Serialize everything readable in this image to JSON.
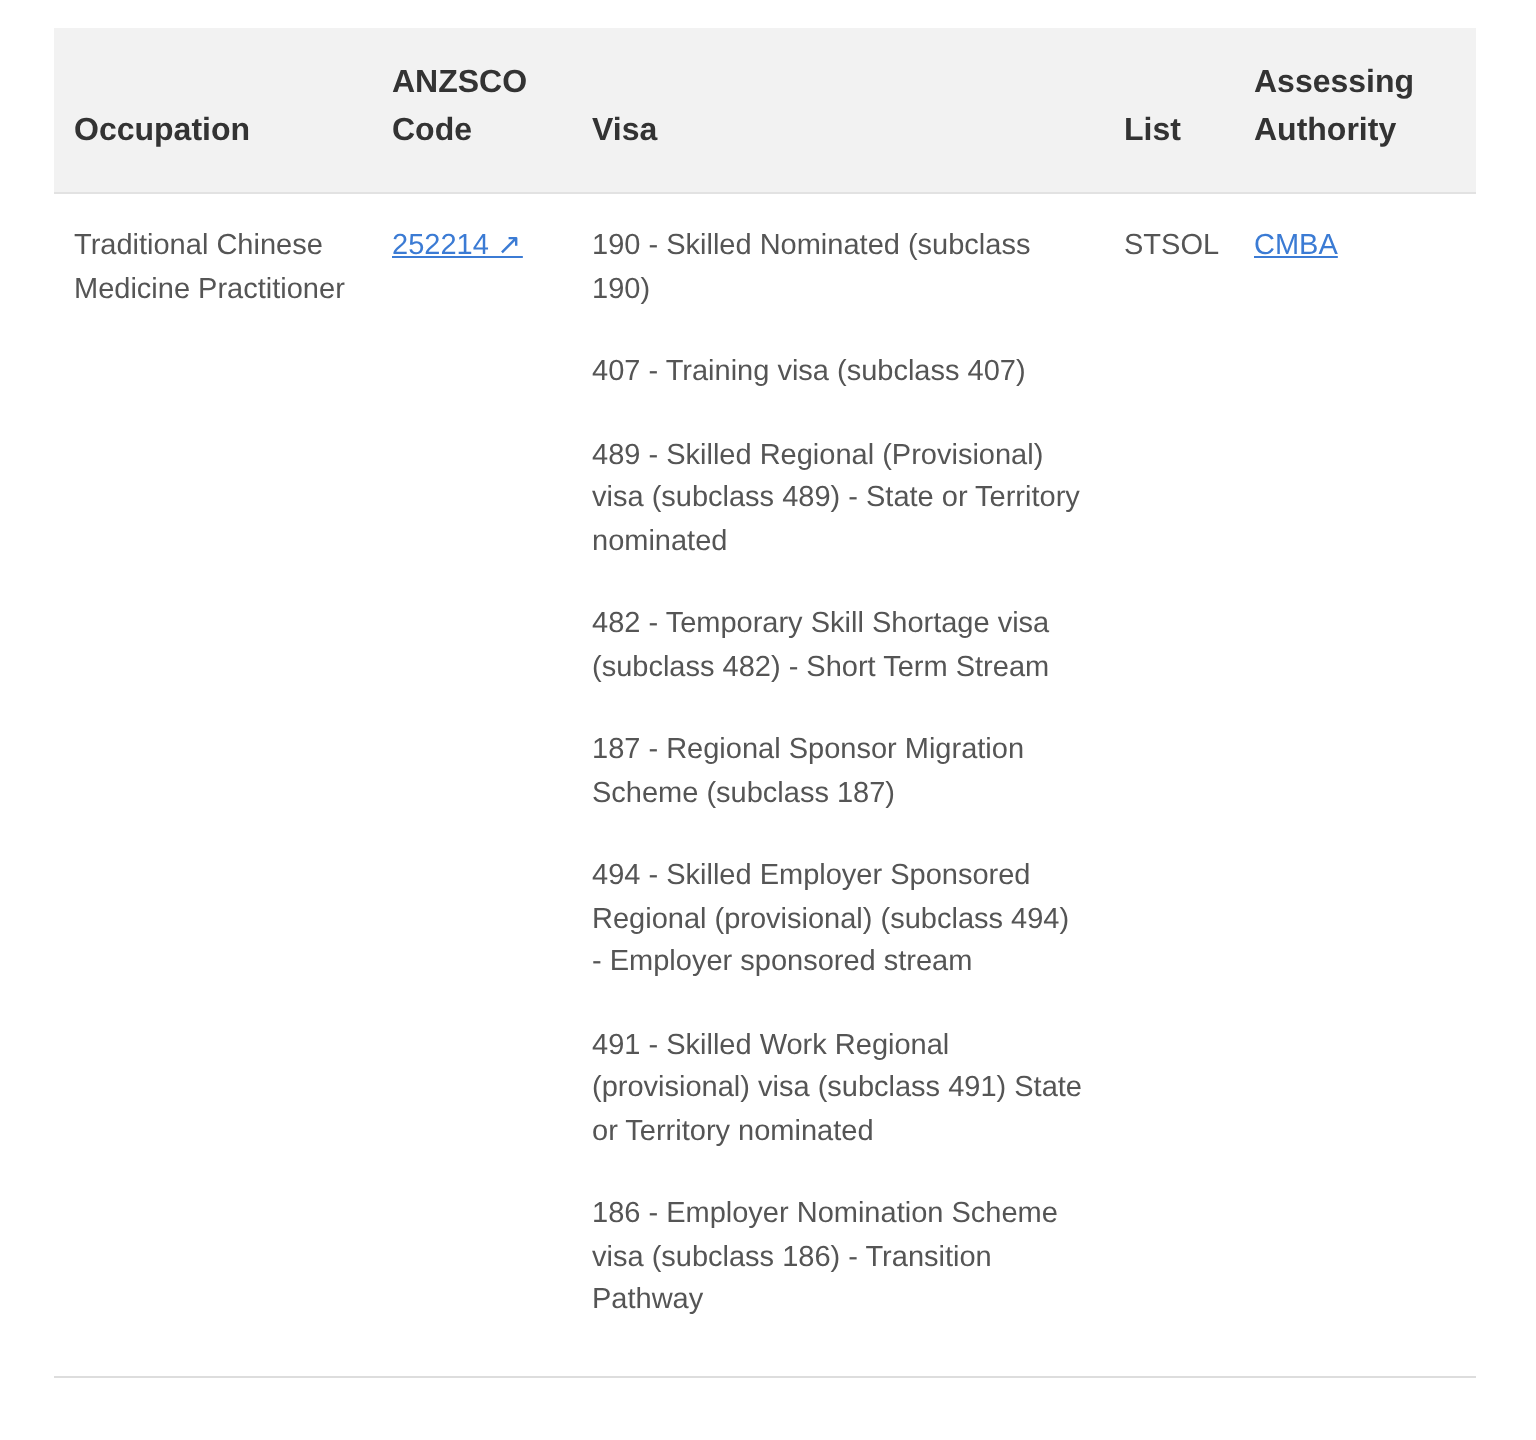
{
  "table": {
    "columns": [
      "Occupation",
      "ANZSCO Code",
      "Visa",
      "List",
      "Assessing Authority"
    ],
    "rows": [
      {
        "occupation": "Traditional Chinese Medicine Practitioner",
        "anzsco_code": "252214 ↗",
        "visas": [
          "190 - Skilled Nominated (subclass 190)",
          "407 - Training visa (subclass 407)",
          "489 - Skilled Regional (Provisional) visa (subclass 489) - State or Territory nominated",
          "482 - Temporary Skill Shortage visa (subclass 482) - Short Term Stream",
          "187 - Regional Sponsor Migration Scheme (subclass 187)",
          "494 - Skilled Employer Sponsored Regional (provisional) (subclass 494) - Employer sponsored stream",
          "491 - Skilled Work Regional (provisional) visa (subclass 491) State or Territory nominated",
          "186 - Employer Nomination Scheme visa (subclass 186) - Transition Pathway"
        ],
        "list": "STSOL",
        "assessing_authority": "CMBA"
      }
    ]
  }
}
